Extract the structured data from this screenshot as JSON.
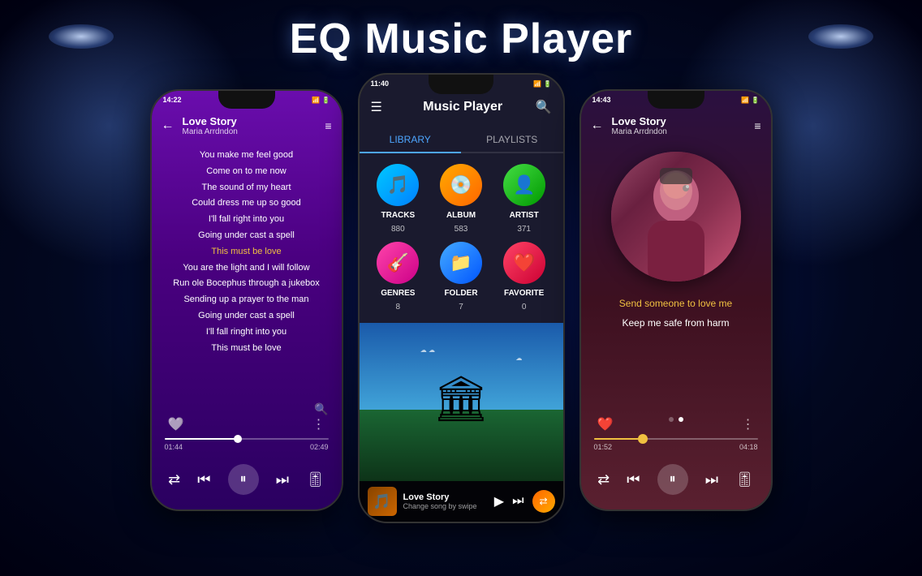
{
  "page": {
    "title": "EQ Music Player",
    "bg_color": "#020820"
  },
  "left_phone": {
    "status_time": "14:22",
    "song_title": "Love Story",
    "song_artist": "Maria Arrdndon",
    "lyrics": [
      {
        "text": "You make me feel good",
        "highlight": false
      },
      {
        "text": "Come on to me now",
        "highlight": false
      },
      {
        "text": "The sound of my heart",
        "highlight": false
      },
      {
        "text": "Could dress me up so good",
        "highlight": false
      },
      {
        "text": "I'll fall right into you",
        "highlight": false
      },
      {
        "text": "Going under cast a spell",
        "highlight": false
      },
      {
        "text": "This must be love",
        "highlight": true
      },
      {
        "text": "You are the light and I will follow",
        "highlight": false
      },
      {
        "text": "Run ole Bocephus through a jukebox",
        "highlight": false
      },
      {
        "text": "Sending up a prayer to the man",
        "highlight": false
      },
      {
        "text": "Going under cast a spell",
        "highlight": false
      },
      {
        "text": "I'll fall ringht into you",
        "highlight": false
      },
      {
        "text": "This must be love",
        "highlight": false
      }
    ],
    "time_current": "01:44",
    "time_total": "02:49",
    "progress_percent": 45
  },
  "center_phone": {
    "status_time": "11:40",
    "app_title": "Music Player",
    "tab_library": "LIBRARY",
    "tab_playlists": "PLAYLISTS",
    "library_items": [
      {
        "icon": "🎵",
        "label": "TRACKS",
        "count": "880",
        "color_class": "tracks-icon"
      },
      {
        "icon": "💿",
        "label": "ALBUM",
        "count": "583",
        "color_class": "album-icon"
      },
      {
        "icon": "👤",
        "label": "ARTIST",
        "count": "371",
        "color_class": "artist-icon"
      },
      {
        "icon": "🎸",
        "label": "GENRES",
        "count": "8",
        "color_class": "genres-icon"
      },
      {
        "icon": "📁",
        "label": "FOLDER",
        "count": "7",
        "color_class": "folder-icon"
      },
      {
        "icon": "❤️",
        "label": "FAVORITE",
        "count": "0",
        "color_class": "favorite-icon"
      }
    ],
    "now_playing_title": "Love Story",
    "now_playing_subtitle": "Change song by swipe"
  },
  "right_phone": {
    "status_time": "14:43",
    "song_title": "Love Story",
    "song_artist": "Maria Arrdndon",
    "lyrics": [
      {
        "text": "Send someone to love me",
        "highlight": true
      },
      {
        "text": "Keep me safe from harm",
        "highlight": false
      }
    ],
    "time_current": "01:52",
    "time_total": "04:18",
    "progress_percent": 30
  }
}
